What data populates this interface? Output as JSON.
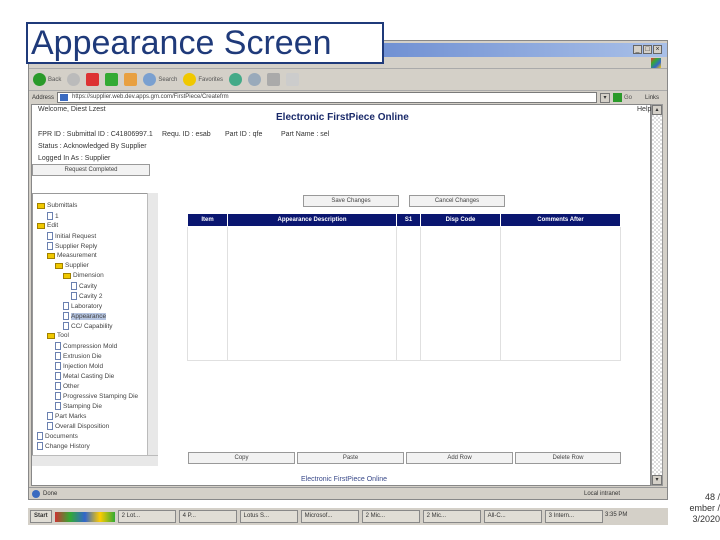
{
  "slide": {
    "title": "Appearance Screen",
    "page": "48 /",
    "date_line1": "ember /",
    "date_line2": "3/2020"
  },
  "browser": {
    "toolbar": {
      "back": "Back",
      "search": "Search",
      "favorites": "Favorites"
    },
    "address_label": "Address",
    "url": "https://supplier.web.dev.apps.gm.com/FirstPiece/Createfrm",
    "go": "Go",
    "links": "Links",
    "status": "Done",
    "zone": "Local intranet"
  },
  "page": {
    "welcome": "Welcome, Diest Lzest",
    "help": "Help",
    "title": "Electronic FirstPiece Online",
    "info": [
      "FPR ID : Submittal ID : C41806997.1",
      "Requ. ID : esab",
      "Part ID : qfe",
      "Part Name : sel"
    ],
    "status": "Status : Acknowledged By Supplier",
    "logged": "Logged In As : Supplier",
    "request_completed": "Request Completed",
    "save": "Save Changes",
    "cancel": "Cancel Changes",
    "columns": [
      "Item",
      "Appearance Description",
      "S1",
      "Disp Code",
      "Comments After"
    ],
    "copy": "Copy",
    "paste": "Paste",
    "add_row": "Add Row",
    "delete_row": "Delete Row",
    "footer": "Electronic FirstPiece Online"
  },
  "tree": [
    {
      "label": "Submittals",
      "t": "f"
    },
    {
      "label": "1",
      "t": "d"
    },
    {
      "label": "Edit",
      "t": "f"
    },
    {
      "label": "Initial Request",
      "t": "d"
    },
    {
      "label": "Supplier Reply",
      "t": "d"
    },
    {
      "label": "Measurement",
      "t": "f"
    },
    {
      "label": "Supplier",
      "t": "f"
    },
    {
      "label": "Dimension",
      "t": "f"
    },
    {
      "label": "Cavity",
      "t": "d"
    },
    {
      "label": "Cavity 2",
      "t": "d"
    },
    {
      "label": "Laboratory",
      "t": "d"
    },
    {
      "label": "Appearance",
      "t": "d"
    },
    {
      "label": "CC/ Capability",
      "t": "d"
    },
    {
      "label": "Tool",
      "t": "f"
    },
    {
      "label": "Compression Mold",
      "t": "d"
    },
    {
      "label": "Extrusion Die",
      "t": "d"
    },
    {
      "label": "Injection Mold",
      "t": "d"
    },
    {
      "label": "Metal Casting Die",
      "t": "d"
    },
    {
      "label": "Other",
      "t": "d"
    },
    {
      "label": "Progressive Stamping Die",
      "t": "d"
    },
    {
      "label": "Stamping Die",
      "t": "d"
    },
    {
      "label": "Part Marks",
      "t": "d"
    },
    {
      "label": "Overall Disposition",
      "t": "d"
    },
    {
      "label": "Documents",
      "t": "d"
    },
    {
      "label": "Change History",
      "t": "d"
    }
  ],
  "taskbar": {
    "start": "Start",
    "items": [
      "2 Lot...",
      "4 P...",
      "Lotus S...",
      "Microsof...",
      "2 Mic...",
      "2 Mic...",
      "All-C...",
      "3 Intern..."
    ],
    "clock": "3:35 PM"
  }
}
